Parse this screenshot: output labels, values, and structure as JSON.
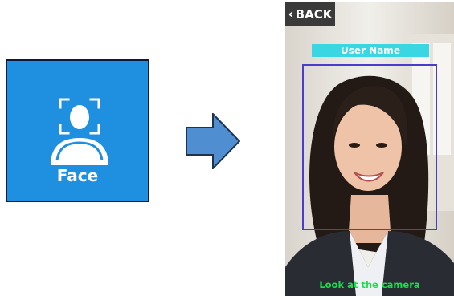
{
  "login_tile": {
    "label": "Face",
    "icon": "face-scan-icon",
    "background_color": "#1f8fe0"
  },
  "transition": {
    "icon": "right-arrow-icon",
    "color": "#4f8ed0"
  },
  "capture_screen": {
    "back_label": "BACK",
    "back_icon": "chevron-left-icon",
    "user_name_label": "User Name",
    "user_name_color": "#3ad7e3",
    "frame_color": "#4a3ccc",
    "hint_text": "Look at the camera",
    "hint_color": "#17e24a"
  }
}
